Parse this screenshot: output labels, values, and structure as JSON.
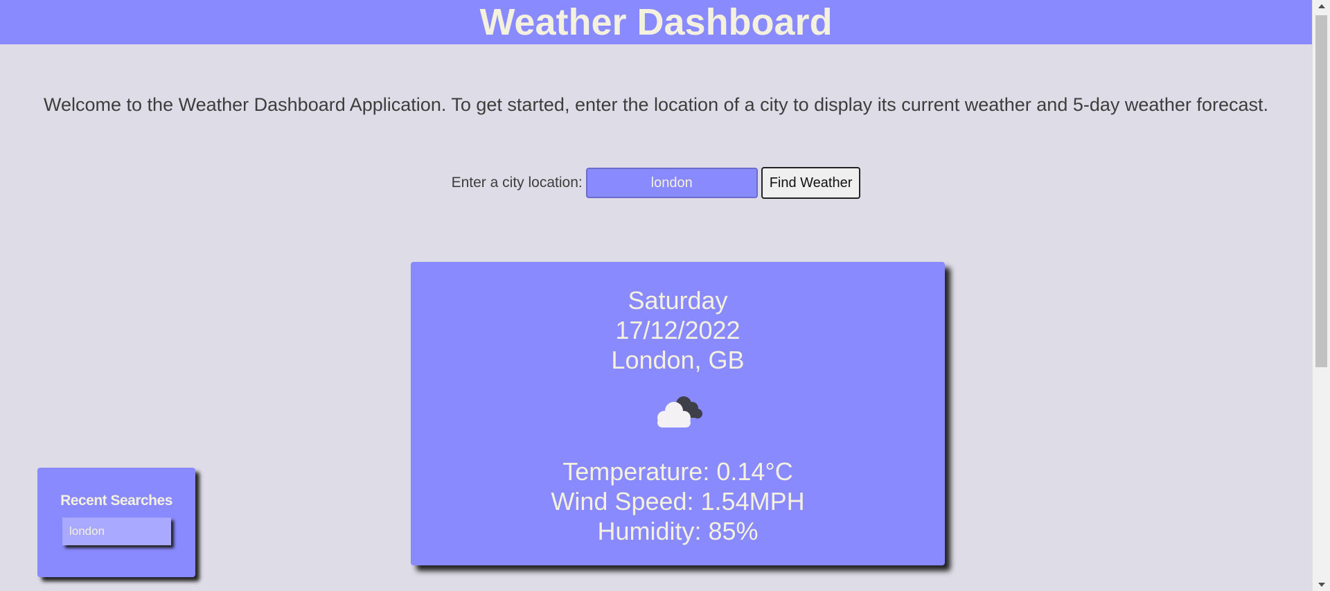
{
  "header": {
    "title": "Weather Dashboard"
  },
  "welcome": {
    "text": "Welcome to the Weather Dashboard Application. To get started, enter the location of a city to display its current weather and 5-day weather forecast."
  },
  "search": {
    "label": "Enter a city location:",
    "value": "london",
    "button_label": "Find Weather"
  },
  "current": {
    "day": "Saturday",
    "date": "17/12/2022",
    "location": "London, GB",
    "icon": "cloud-icon",
    "temperature": "Temperature: 0.14°C",
    "wind": "Wind Speed: 1.54MPH",
    "humidity": "Humidity: 85%"
  },
  "recent": {
    "title": "Recent Searches",
    "items": [
      "london"
    ]
  },
  "colors": {
    "accent": "#8a8aff",
    "text_light": "#f4f1de",
    "background": "#dedce6"
  }
}
